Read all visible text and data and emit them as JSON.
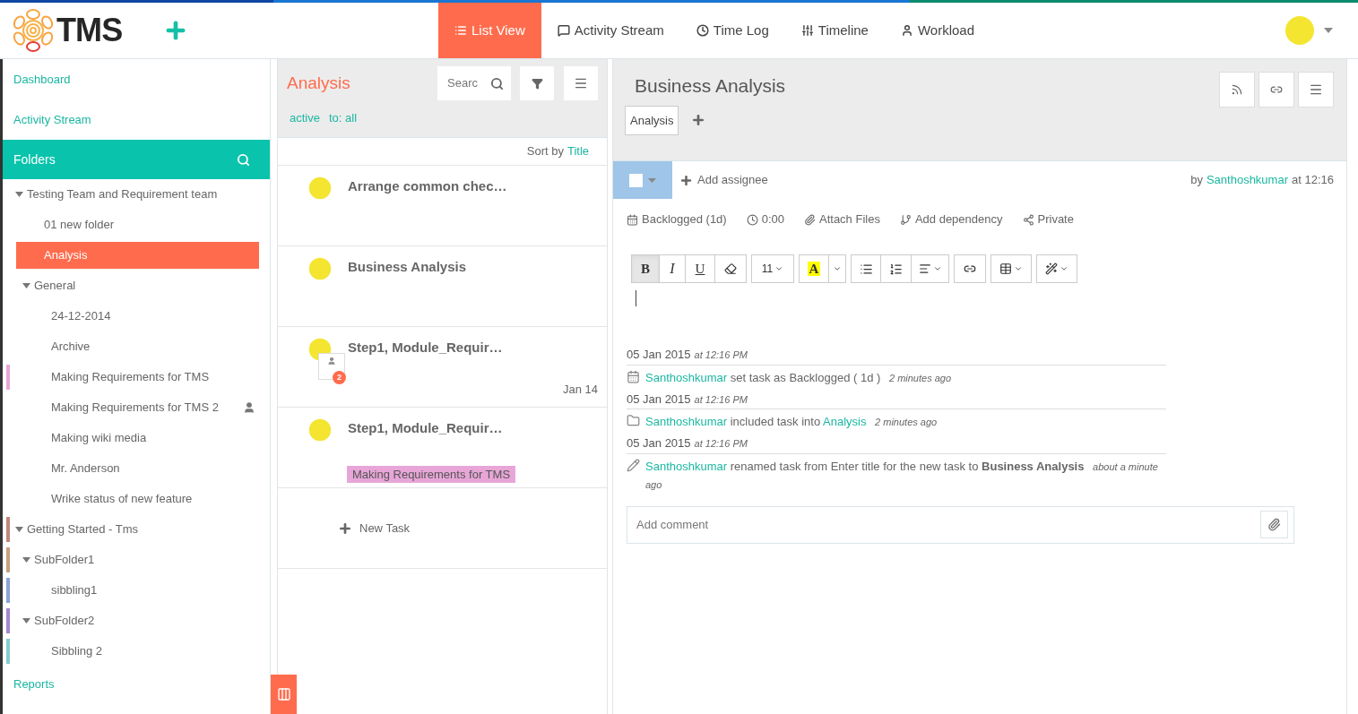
{
  "header": {
    "logo": "TMS",
    "nav": [
      {
        "label": "List View",
        "selected": true
      },
      {
        "label": "Activity Stream",
        "selected": false
      },
      {
        "label": "Time Log",
        "selected": false
      },
      {
        "label": "Timeline",
        "selected": false
      },
      {
        "label": "Workload",
        "selected": false
      }
    ]
  },
  "sidebar": {
    "links_top": [
      "Dashboard",
      "Activity Stream"
    ],
    "folders_title": "Folders",
    "tree": [
      {
        "label": "Testing Team and Requirement team",
        "expanded": true,
        "selected": false,
        "children": [
          {
            "label": "01 new folder",
            "selected": false
          },
          {
            "label": "Analysis",
            "selected": true
          },
          {
            "label": "General",
            "expanded": true,
            "selected": false,
            "children": [
              {
                "label": "24-12-2014",
                "selected": false
              },
              {
                "label": "Archive",
                "selected": false
              },
              {
                "label": "Making Requirements for TMS",
                "selected": false,
                "color": "#e8a6d8"
              },
              {
                "label": "Making Requirements for TMS 2",
                "selected": false,
                "shared": true
              },
              {
                "label": "Making wiki media",
                "selected": false
              },
              {
                "label": "Mr. Anderson",
                "selected": false
              },
              {
                "label": "Wrike status of new feature",
                "selected": false
              }
            ]
          }
        ]
      },
      {
        "label": "Getting Started - Tms",
        "expanded": true,
        "selected": false,
        "color": "#c0877c",
        "children": [
          {
            "label": "SubFolder1",
            "expanded": true,
            "selected": false,
            "color": "#c9a07f",
            "children": [
              {
                "label": "sibbling1",
                "selected": false,
                "color": "#8aa4d4"
              }
            ]
          },
          {
            "label": "SubFolder2",
            "expanded": true,
            "selected": false,
            "color": "#a287cf",
            "children": [
              {
                "label": "Sibbling 2",
                "selected": false,
                "color": "#86cccc"
              }
            ]
          }
        ]
      }
    ],
    "links_bottom": [
      "Reports"
    ]
  },
  "task_list": {
    "title": "Analysis",
    "search": {
      "placeholder": "Searc"
    },
    "filters": [
      "active",
      "to: all"
    ],
    "sort_label": "Sort by",
    "sort_value": "Title",
    "tasks": [
      {
        "title": "Arrange common chec…",
        "selected": false
      },
      {
        "title": "Business Analysis",
        "selected": false
      },
      {
        "title": "Step1, Module_Requir…",
        "selected": false,
        "badge": "2",
        "date": "Jan 14"
      },
      {
        "title": "Step1, Module_Requir…",
        "selected": false,
        "tag": {
          "label": "Making Requirements for TMS",
          "color": "#e8a6d8"
        }
      }
    ],
    "new_task": "New Task"
  },
  "task": {
    "title": "Business Analysis",
    "folders": [
      "Analysis"
    ],
    "checked": false,
    "add_assignee": "Add assignee",
    "by_label": "by",
    "author": "Santhoshkumar",
    "at_label": "at 12:16",
    "meta": [
      "Backlogged (1d)",
      "0:00",
      "Attach Files",
      "Add dependency",
      "Private"
    ],
    "toolbar": [
      [
        {
          "kind": "bold",
          "label": "B",
          "active": true
        },
        {
          "kind": "italic",
          "label": "I",
          "active": false
        },
        {
          "kind": "underline",
          "label": "U",
          "active": false
        },
        {
          "kind": "eraser",
          "active": false
        }
      ],
      [
        {
          "kind": "size",
          "label": "11",
          "active": false
        }
      ],
      [
        {
          "kind": "color",
          "label": "A",
          "active": false
        },
        {
          "kind": "caret",
          "active": false
        }
      ],
      [
        {
          "kind": "ul",
          "active": false
        },
        {
          "kind": "ol",
          "active": false
        },
        {
          "kind": "align",
          "active": false
        }
      ],
      [
        {
          "kind": "link",
          "active": false
        }
      ],
      [
        {
          "kind": "table",
          "active": false
        }
      ],
      [
        {
          "kind": "magic",
          "active": false
        }
      ]
    ],
    "activity": [
      {
        "date": "05 Jan 2015",
        "time": "at 12:16 PM",
        "kind": "status",
        "user": "Santhoshkumar",
        "text": "set task as Backlogged ( 1d )",
        "ago": "2 minutes ago"
      },
      {
        "date": "05 Jan 2015",
        "time": "at 12:16 PM",
        "kind": "folder",
        "user": "Santhoshkumar",
        "text": "included task into",
        "link": "Analysis",
        "ago": "2 minutes ago"
      },
      {
        "date": "05 Jan 2015",
        "time": "at 12:16 PM",
        "kind": "rename",
        "user": "Santhoshkumar",
        "text": "renamed task from Enter title for the new task to **Business Analysis**",
        "ago": "about a minute ago"
      }
    ],
    "comment": {
      "placeholder": "Add comment"
    }
  }
}
